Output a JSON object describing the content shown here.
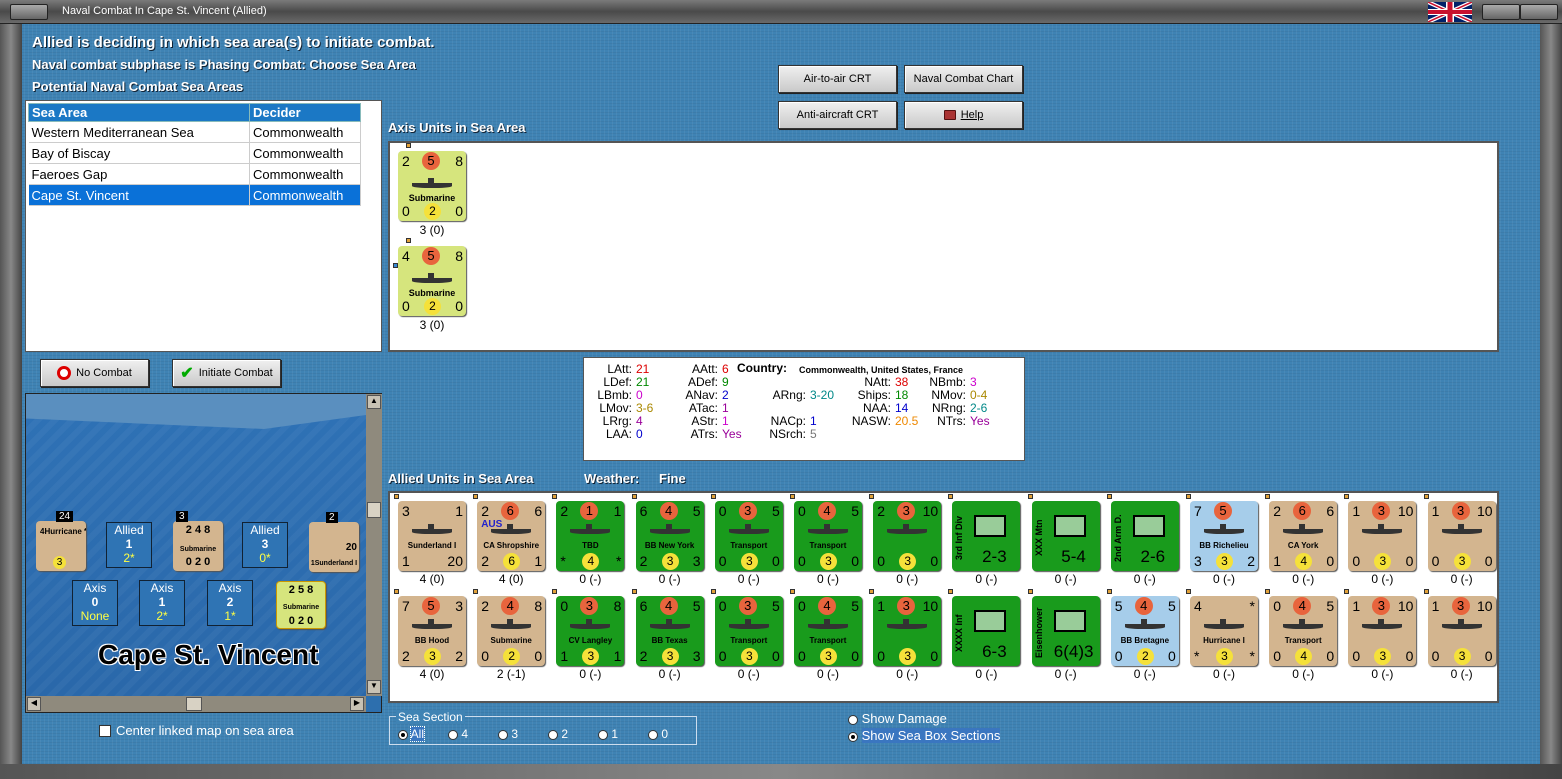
{
  "window": {
    "title": "Naval Combat In Cape St. Vincent (Allied)"
  },
  "header": {
    "line1": "Allied is deciding in which sea area(s) to initiate combat.",
    "line2": "Naval combat subphase is Phasing Combat: Choose Sea Area",
    "line3": "Potential Naval Combat Sea Areas"
  },
  "table": {
    "headers": [
      "Sea Area",
      "Decider"
    ],
    "rows": [
      {
        "area": "Western Mediterranean Sea",
        "decider": "Commonwealth"
      },
      {
        "area": "Bay of Biscay",
        "decider": "Commonwealth"
      },
      {
        "area": "Faeroes Gap",
        "decider": "Commonwealth"
      },
      {
        "area": "Cape St. Vincent",
        "decider": "Commonwealth"
      }
    ],
    "selected_row": 3
  },
  "buttons": {
    "air_to_air": "Air-to-air CRT",
    "naval_chart": "Naval Combat Chart",
    "anti_aircraft": "Anti-aircraft CRT",
    "help": "Help",
    "no_combat": "No Combat",
    "initiate_combat": "Initiate Combat"
  },
  "axis": {
    "title": "Axis Units in Sea Area",
    "units": [
      {
        "tl": "2",
        "tc": "5",
        "tr": "8",
        "name": "Submarine",
        "bl": "0",
        "bc": "2",
        "br": "0",
        "str": "3 (0)"
      },
      {
        "tl": "4",
        "tc": "5",
        "tr": "8",
        "name": "Submarine",
        "bl": "0",
        "bc": "2",
        "br": "0",
        "str": "3 (0)"
      }
    ]
  },
  "stats": {
    "country_label": "Country:",
    "country": "Commonwealth, United States, France",
    "items": [
      {
        "k": "LAtt:",
        "v": "21",
        "c": "#d00"
      },
      {
        "k": "LDef:",
        "v": "21",
        "c": "#080"
      },
      {
        "k": "LBmb:",
        "v": "0",
        "c": "#c0c"
      },
      {
        "k": "LMov:",
        "v": "3-6",
        "c": "#a80"
      },
      {
        "k": "LRrg:",
        "v": "4",
        "c": "#909"
      },
      {
        "k": "LAA:",
        "v": "0",
        "c": "#00c"
      },
      {
        "k": "AAtt:",
        "v": "6",
        "c": "#d00"
      },
      {
        "k": "ADef:",
        "v": "9",
        "c": "#080"
      },
      {
        "k": "ANav:",
        "v": "2",
        "c": "#00c"
      },
      {
        "k": "ATac:",
        "v": "1",
        "c": "#909"
      },
      {
        "k": "AStr:",
        "v": "1",
        "c": "#c0c"
      },
      {
        "k": "ATrs:",
        "v": "Yes",
        "c": "#909"
      },
      {
        "k": "ARng:",
        "v": "3-20",
        "c": "#088"
      },
      {
        "k": "NACp:",
        "v": "1",
        "c": "#00c"
      },
      {
        "k": "NSrch:",
        "v": "5",
        "c": "#777"
      },
      {
        "k": "NAtt:",
        "v": "38",
        "c": "#d00"
      },
      {
        "k": "Ships:",
        "v": "18",
        "c": "#080"
      },
      {
        "k": "NAA:",
        "v": "14",
        "c": "#00c"
      },
      {
        "k": "NASW:",
        "v": "20.5",
        "c": "#e80"
      },
      {
        "k": "NBmb:",
        "v": "3",
        "c": "#c0c"
      },
      {
        "k": "NMov:",
        "v": "0-4",
        "c": "#a80"
      },
      {
        "k": "NRng:",
        "v": "2-6",
        "c": "#088"
      },
      {
        "k": "NTrs:",
        "v": "Yes",
        "c": "#909"
      }
    ]
  },
  "allied": {
    "title": "Allied Units in Sea Area",
    "weather_label": "Weather:",
    "weather": "Fine",
    "row1": [
      {
        "tl": "3",
        "tc": "",
        "tr": "1",
        "name": "Sunderland I",
        "bl": "1",
        "bc": "",
        "br": "20",
        "str": "4 (0)",
        "bg": "c-tan"
      },
      {
        "tl": "2",
        "tc": "6",
        "tr": "6",
        "name": "CA Shropshire",
        "bl": "2",
        "bc": "6",
        "br": "1",
        "str": "4 (0)",
        "bg": "c-tan",
        "tag": "AUS"
      },
      {
        "tl": "2",
        "tc": "1",
        "tr": "1",
        "name": "TBD",
        "bl": "*",
        "bc": "4",
        "br": "*",
        "str": "0 (-)",
        "bg": "c-green"
      },
      {
        "tl": "6",
        "tc": "4",
        "tr": "5",
        "name": "BB New York",
        "bl": "2",
        "bc": "3",
        "br": "3",
        "str": "0 (-)",
        "bg": "c-green"
      },
      {
        "tl": "0",
        "tc": "3",
        "tr": "5",
        "name": "Transport",
        "bl": "0",
        "bc": "3",
        "br": "0",
        "str": "0 (-)",
        "bg": "c-green"
      },
      {
        "tl": "0",
        "tc": "4",
        "tr": "5",
        "name": "Transport",
        "bl": "0",
        "bc": "3",
        "br": "0",
        "str": "0 (-)",
        "bg": "c-green"
      },
      {
        "tl": "2",
        "tc": "3",
        "tr": "10",
        "name": "",
        "bl": "0",
        "bc": "3",
        "br": "0",
        "str": "0 (-)",
        "bg": "c-green"
      },
      {
        "tl": "",
        "tc": "",
        "tr": "",
        "name": "3rd Inf Div",
        "bl": "",
        "bc": "2-3",
        "br": "",
        "str": "0 (-)",
        "bg": "c-green"
      },
      {
        "tl": "",
        "tc": "",
        "tr": "",
        "name": "XXX Mtn",
        "bl": "",
        "bc": "5-4",
        "br": "",
        "str": "0 (-)",
        "bg": "c-green"
      },
      {
        "tl": "",
        "tc": "",
        "tr": "",
        "name": "2nd Arm D.",
        "bl": "",
        "bc": "2-6",
        "br": "",
        "str": "0 (-)",
        "bg": "c-green"
      },
      {
        "tl": "7",
        "tc": "5",
        "tr": "",
        "name": "BB Richelieu",
        "bl": "3",
        "bc": "3",
        "br": "2",
        "str": "0 (-)",
        "bg": "c-blue"
      },
      {
        "tl": "2",
        "tc": "6",
        "tr": "6",
        "name": "CA York",
        "bl": "1",
        "bc": "4",
        "br": "0",
        "str": "0 (-)",
        "bg": "c-tan"
      },
      {
        "tl": "1",
        "tc": "3",
        "tr": "10",
        "name": "",
        "bl": "0",
        "bc": "3",
        "br": "0",
        "str": "0 (-)",
        "bg": "c-tan"
      },
      {
        "tl": "1",
        "tc": "3",
        "tr": "10",
        "name": "",
        "bl": "0",
        "bc": "3",
        "br": "0",
        "str": "0 (-)",
        "bg": "c-tan"
      }
    ],
    "row2": [
      {
        "tl": "7",
        "tc": "5",
        "tr": "3",
        "name": "BB Hood",
        "bl": "2",
        "bc": "3",
        "br": "2",
        "str": "4 (0)",
        "bg": "c-tan"
      },
      {
        "tl": "2",
        "tc": "4",
        "tr": "8",
        "name": "Submarine",
        "bl": "0",
        "bc": "2",
        "br": "0",
        "str": "2 (-1)",
        "bg": "c-tan"
      },
      {
        "tl": "0",
        "tc": "3",
        "tr": "8",
        "name": "CV Langley",
        "bl": "1",
        "bc": "3",
        "br": "1",
        "str": "0 (-)",
        "bg": "c-green"
      },
      {
        "tl": "6",
        "tc": "4",
        "tr": "5",
        "name": "BB Texas",
        "bl": "2",
        "bc": "3",
        "br": "3",
        "str": "0 (-)",
        "bg": "c-green"
      },
      {
        "tl": "0",
        "tc": "3",
        "tr": "5",
        "name": "Transport",
        "bl": "0",
        "bc": "3",
        "br": "0",
        "str": "0 (-)",
        "bg": "c-green"
      },
      {
        "tl": "0",
        "tc": "4",
        "tr": "5",
        "name": "Transport",
        "bl": "0",
        "bc": "3",
        "br": "0",
        "str": "0 (-)",
        "bg": "c-green"
      },
      {
        "tl": "1",
        "tc": "3",
        "tr": "10",
        "name": "",
        "bl": "0",
        "bc": "3",
        "br": "0",
        "str": "0 (-)",
        "bg": "c-green"
      },
      {
        "tl": "",
        "tc": "",
        "tr": "",
        "name": "XXXX Inf",
        "bl": "",
        "bc": "6-3",
        "br": "",
        "str": "0 (-)",
        "bg": "c-green"
      },
      {
        "tl": "",
        "tc": "",
        "tr": "",
        "name": "Eisenhower",
        "bl": "",
        "bc": "6(4)3",
        "br": "",
        "str": "0 (-)",
        "bg": "c-green"
      },
      {
        "tl": "5",
        "tc": "4",
        "tr": "5",
        "name": "BB Bretagne",
        "bl": "0",
        "bc": "2",
        "br": "0",
        "str": "0 (-)",
        "bg": "c-blue"
      },
      {
        "tl": "4",
        "tc": "",
        "tr": "*",
        "name": "Hurricane I",
        "bl": "*",
        "bc": "3",
        "br": "*",
        "str": "0 (-)",
        "bg": "c-tan"
      },
      {
        "tl": "0",
        "tc": "4",
        "tr": "5",
        "name": "Transport",
        "bl": "0",
        "bc": "4",
        "br": "0",
        "str": "0 (-)",
        "bg": "c-tan"
      },
      {
        "tl": "1",
        "tc": "3",
        "tr": "10",
        "name": "",
        "bl": "0",
        "bc": "3",
        "br": "0",
        "str": "0 (-)",
        "bg": "c-tan"
      },
      {
        "tl": "1",
        "tc": "3",
        "tr": "10",
        "name": "",
        "bl": "0",
        "bc": "3",
        "br": "0",
        "str": "0 (-)",
        "bg": "c-tan"
      }
    ]
  },
  "map": {
    "sea_name": "Cape St. Vincent",
    "allied_boxes": [
      {
        "label": "Allied",
        "num": "1",
        "sub": "2*"
      },
      {
        "label": "Allied",
        "num": "3",
        "sub": "0*"
      }
    ],
    "axis_boxes": [
      {
        "label": "Axis",
        "num": "0",
        "sub": "None"
      },
      {
        "label": "Axis",
        "num": "1",
        "sub": "2*"
      },
      {
        "label": "Axis",
        "num": "2",
        "sub": "1*"
      }
    ],
    "stack_counts": [
      "24",
      "3",
      "2"
    ],
    "center_label": "Center linked map on sea area"
  },
  "sea_section": {
    "title": "Sea Section",
    "options": [
      "All",
      "4",
      "3",
      "2",
      "1",
      "0"
    ]
  },
  "display": {
    "show_damage": "Show Damage",
    "show_sections": "Show Sea Box Sections"
  }
}
